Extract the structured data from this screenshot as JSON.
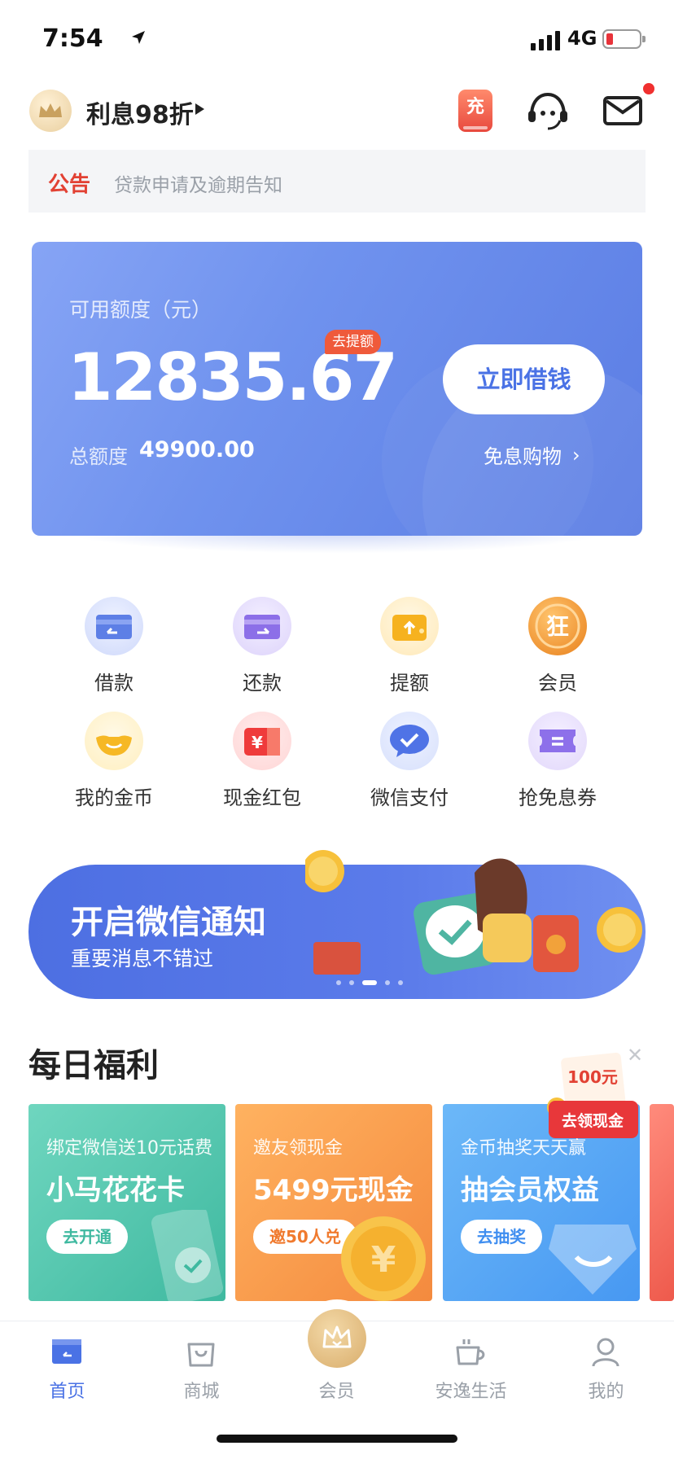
{
  "status_bar": {
    "time": "7:54",
    "network": "4G"
  },
  "header": {
    "member_text": "利息98折",
    "recharge_icon_text": "充"
  },
  "notice": {
    "tag": "公告",
    "text": "贷款申请及逾期告知"
  },
  "credit": {
    "label": "可用额度（元）",
    "amount": "12835.67",
    "raise_badge": "去提额",
    "borrow_button": "立即借钱",
    "total_label": "总额度",
    "total_amount": "49900.00",
    "free_shopping": "免息购物",
    "colors": {
      "card_start": "#86a4f5",
      "card_end": "#5b7de4",
      "badge": "#ef5a3b"
    }
  },
  "grid": {
    "items": [
      {
        "label": "借款",
        "icon": "card-borrow-icon"
      },
      {
        "label": "还款",
        "icon": "card-repay-icon"
      },
      {
        "label": "提额",
        "icon": "wallet-raise-icon"
      },
      {
        "label": "会员",
        "icon": "vip-crown-icon",
        "icon_text": "狂"
      },
      {
        "label": "我的金币",
        "icon": "gold-ingot-icon"
      },
      {
        "label": "现金红包",
        "icon": "red-packet-icon",
        "icon_text": "¥"
      },
      {
        "label": "微信支付",
        "icon": "wechat-check-icon"
      },
      {
        "label": "抢免息券",
        "icon": "coupon-icon"
      }
    ]
  },
  "banner": {
    "title": "开启微信通知",
    "subtitle": "重要消息不错过",
    "dots": 5,
    "active_dot": 2
  },
  "daily": {
    "title": "每日福利",
    "sticker": {
      "amount": "100元",
      "label": "去领现金"
    },
    "cards": [
      {
        "subtitle": "绑定微信送10元话费",
        "title": "小马花花卡",
        "button": "去开通",
        "button_color": "#3fb9a0"
      },
      {
        "subtitle": "邀友领现金",
        "title": "5499元现金",
        "button": "邀50人兑",
        "button_color": "#f07a2e"
      },
      {
        "subtitle": "金币抽奖天天赢",
        "title": "抽会员权益",
        "button": "去抽奖",
        "button_color": "#3f8ef0"
      }
    ]
  },
  "tabbar": {
    "tabs": [
      {
        "label": "首页",
        "icon": "home-icon",
        "active": true
      },
      {
        "label": "商城",
        "icon": "shopping-bag-icon",
        "active": false
      },
      {
        "label": "会员",
        "icon": "vip-crown-icon",
        "active": false
      },
      {
        "label": "安逸生活",
        "icon": "coffee-cup-icon",
        "active": false
      },
      {
        "label": "我的",
        "icon": "person-icon",
        "active": false
      }
    ]
  }
}
